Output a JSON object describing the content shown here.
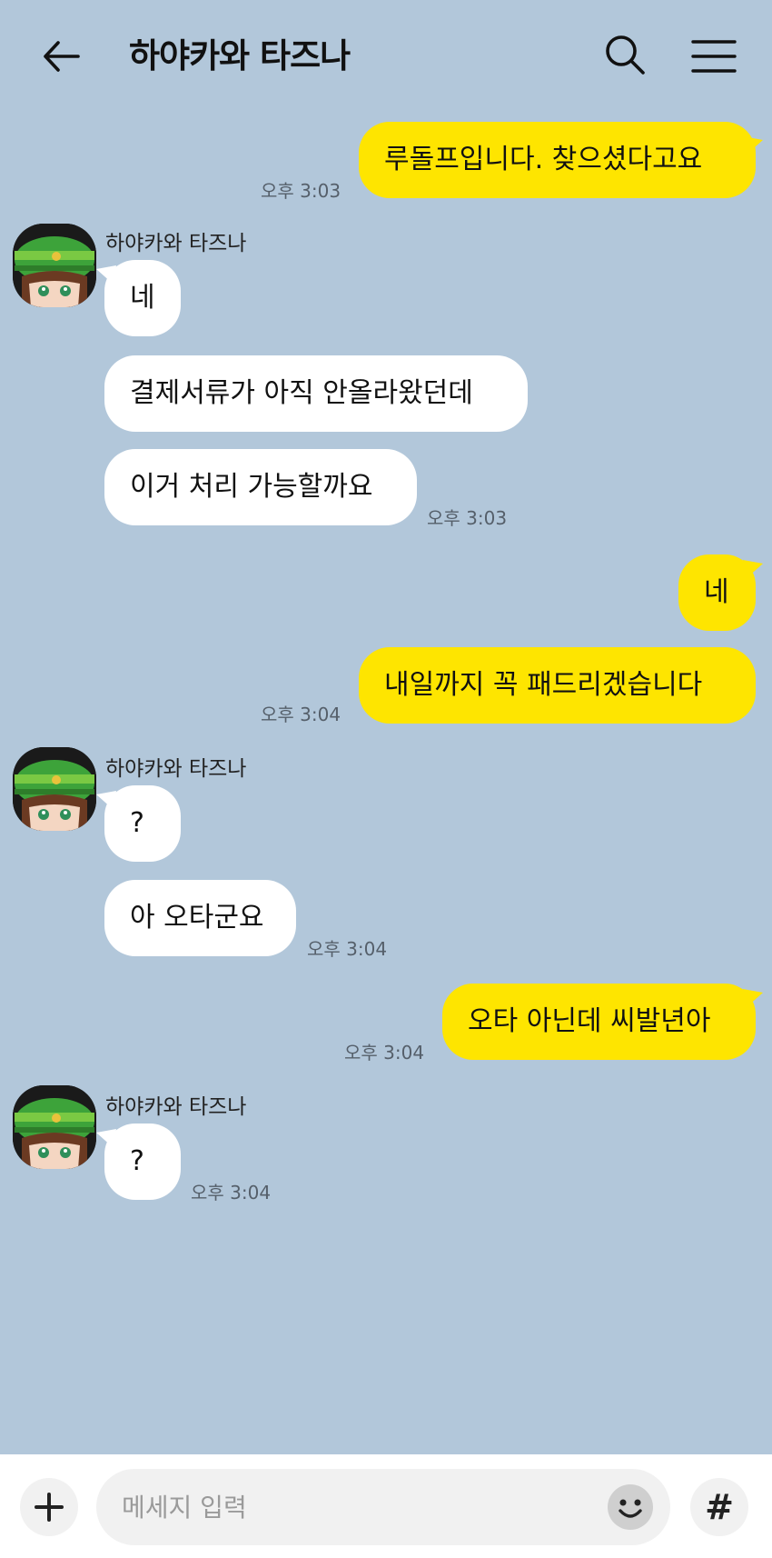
{
  "header": {
    "title": "하야카와 타즈나",
    "back_icon": "arrow-left-icon",
    "search_icon": "search-icon",
    "menu_icon": "hamburger-menu-icon"
  },
  "colors": {
    "background": "#b2c7da",
    "my_bubble": "#fee500",
    "their_bubble": "#ffffff"
  },
  "messages": [
    {
      "from": "me",
      "text": "루돌프입니다. 찾으셨다고요",
      "time": "오후 3:03"
    },
    {
      "from": "them",
      "sender": "하야카와 타즈나",
      "text": "네"
    },
    {
      "from": "them",
      "text": "결제서류가 아직 안올라왔던데"
    },
    {
      "from": "them",
      "text": "이거 처리 가능할까요",
      "time": "오후 3:03"
    },
    {
      "from": "me",
      "text": "네"
    },
    {
      "from": "me",
      "text": "내일까지 꼭 패드리겠습니다",
      "time": "오후 3:04"
    },
    {
      "from": "them",
      "sender": "하야카와 타즈나",
      "text": "?"
    },
    {
      "from": "them",
      "text": "아 오타군요",
      "time": "오후 3:04"
    },
    {
      "from": "me",
      "text": "오타 아닌데 씨발년아",
      "time": "오후 3:04"
    },
    {
      "from": "them",
      "sender": "하야카와 타즈나",
      "text": "?",
      "time": "오후 3:04"
    }
  ],
  "input_bar": {
    "plus_label": "+",
    "placeholder": "메세지 입력",
    "emoji_icon": "smiley-icon",
    "hash_label": "#"
  }
}
